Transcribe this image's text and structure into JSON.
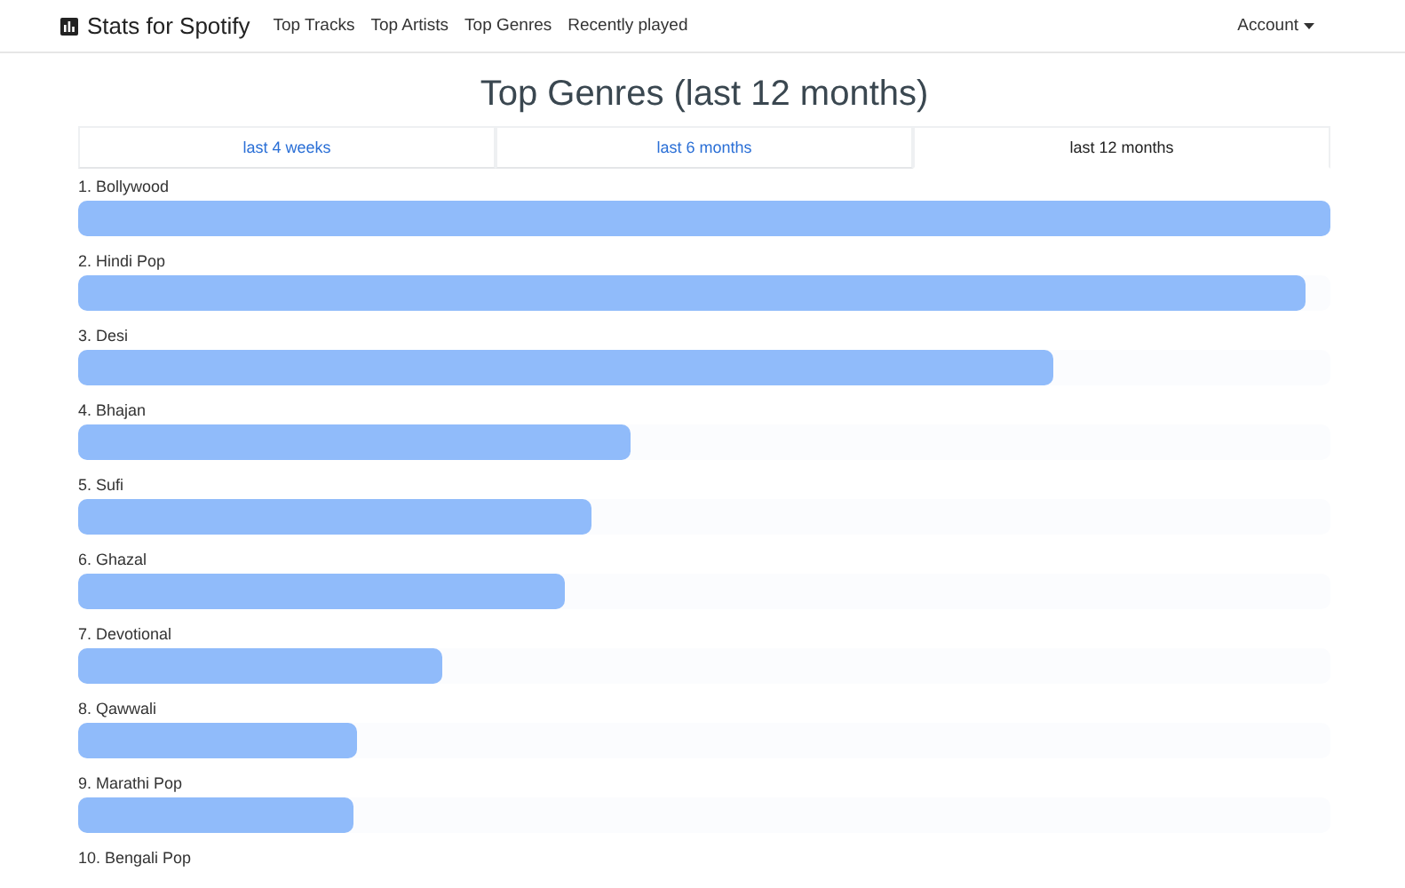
{
  "navbar": {
    "brand": "Stats for Spotify",
    "links": [
      "Top Tracks",
      "Top Artists",
      "Top Genres",
      "Recently played"
    ],
    "account": "Account"
  },
  "title": "Top Genres (last 12 months)",
  "tabs": [
    {
      "label": "last 4 weeks",
      "selected": false
    },
    {
      "label": "last 6 months",
      "selected": false
    },
    {
      "label": "last 12 months",
      "selected": true
    }
  ],
  "genres": [
    {
      "label": "1. Bollywood",
      "level": 1.0
    },
    {
      "label": "2. Hindi Pop",
      "level": 0.98
    },
    {
      "label": "3. Desi",
      "level": 0.779
    },
    {
      "label": "4. Bhajan",
      "level": 0.441
    },
    {
      "label": "5. Sufi",
      "level": 0.41
    },
    {
      "label": "6. Ghazal",
      "level": 0.389
    },
    {
      "label": "7. Devotional",
      "level": 0.291
    },
    {
      "label": "8. Qawwali",
      "level": 0.223
    },
    {
      "label": "9. Marathi Pop",
      "level": 0.22
    },
    {
      "label": "10. Bengali Pop"
    }
  ]
}
